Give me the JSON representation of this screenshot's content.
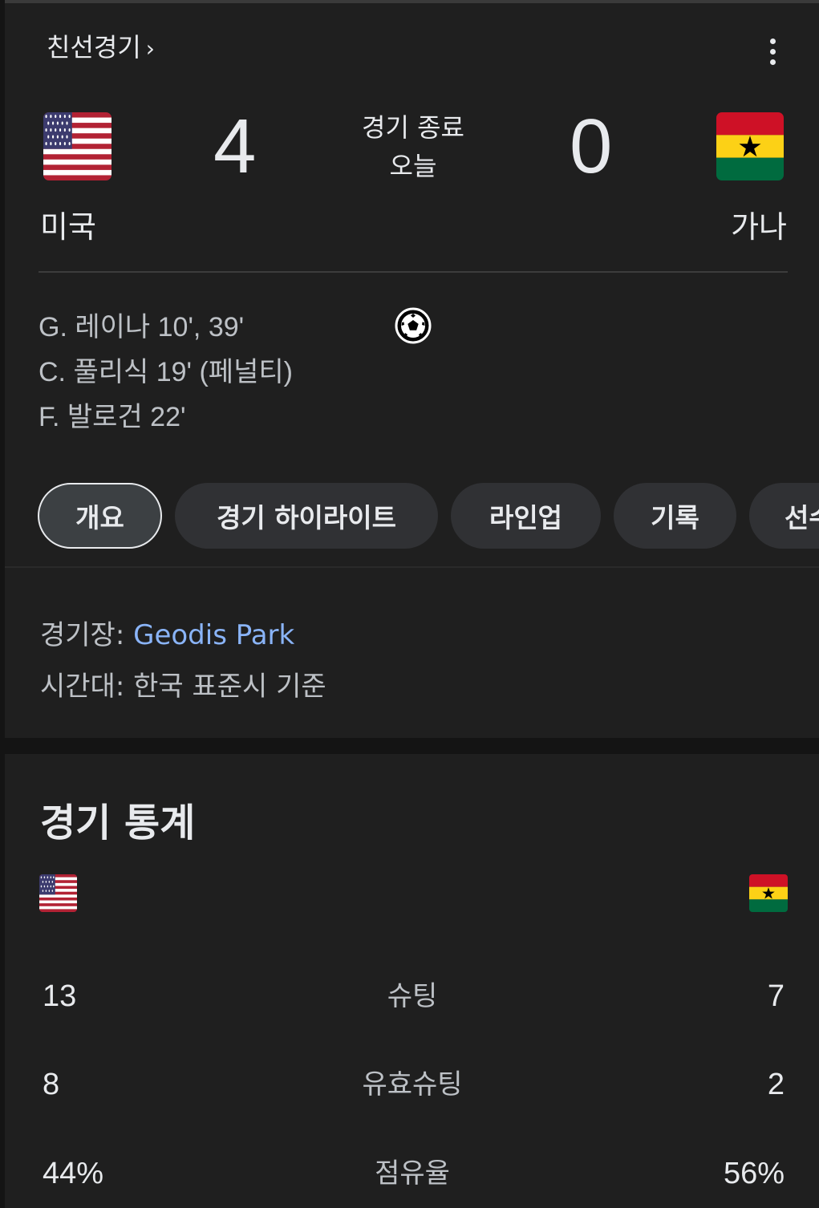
{
  "header": {
    "competition": "친선경기",
    "competition_chevron": "›",
    "more_icon": "more-vert-icon"
  },
  "match": {
    "home_team": "미국",
    "away_team": "가나",
    "home_score": "4",
    "away_score": "0",
    "status": "경기 종료",
    "date": "오늘"
  },
  "scorers": [
    "G. 레이나 10', 39'",
    "C. 풀리식 19' (페널티)",
    "F. 발로건 22'"
  ],
  "tabs": [
    {
      "label": "개요",
      "active": true
    },
    {
      "label": "경기 하이라이트",
      "active": false
    },
    {
      "label": "라인업",
      "active": false
    },
    {
      "label": "기록",
      "active": false
    },
    {
      "label": "선수",
      "active": false
    }
  ],
  "info": {
    "venue_label": "경기장: ",
    "venue_value": "Geodis Park",
    "timezone_label": "시간대: ",
    "timezone_value": "한국 표준시 기준"
  },
  "stats": {
    "title": "경기 통계",
    "rows": [
      {
        "label": "슈팅",
        "home": "13",
        "away": "7"
      },
      {
        "label": "유효슈팅",
        "home": "8",
        "away": "2"
      },
      {
        "label": "점유율",
        "home": "44%",
        "away": "56%"
      }
    ]
  },
  "colors": {
    "background": "#1f1f1f",
    "link": "#8ab4f8",
    "chip": "#303134"
  }
}
